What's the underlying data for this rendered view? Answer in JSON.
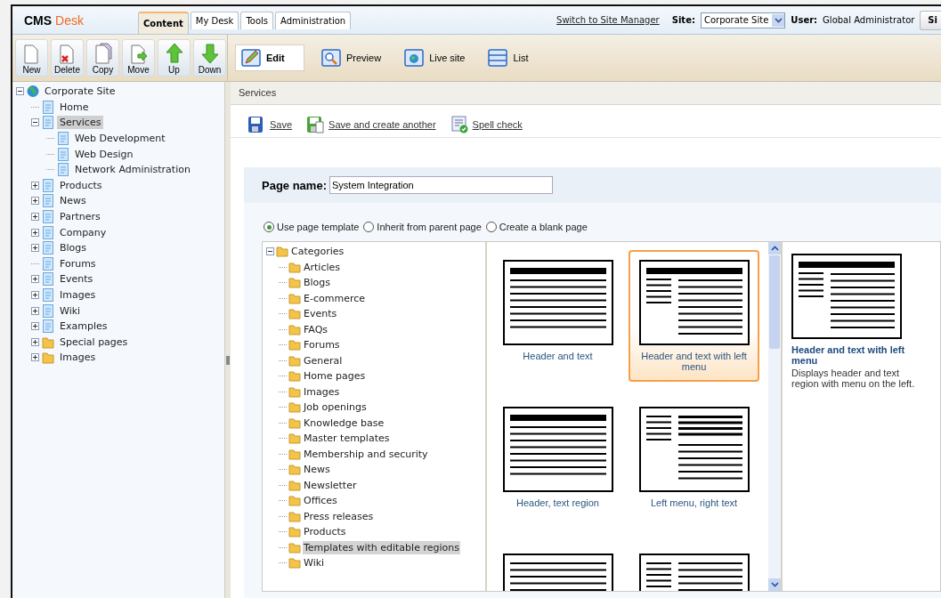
{
  "header": {
    "logo_bold": "CMS",
    "logo_accent": "Desk",
    "tabs": [
      {
        "label": "Content",
        "selected": true
      },
      {
        "label": "My Desk",
        "selected": false
      },
      {
        "label": "Tools",
        "selected": false
      },
      {
        "label": "Administration",
        "selected": false
      }
    ],
    "switch_link": "Switch to Site Manager",
    "site_label": "Site:",
    "site_value": "Corporate Site",
    "user_label": "User:",
    "user_value": "Global Administrator",
    "sign_button": "Si"
  },
  "tree_toolbar": [
    {
      "label": "New",
      "kind": "new"
    },
    {
      "label": "Delete",
      "kind": "delete"
    },
    {
      "label": "Copy",
      "kind": "copy"
    },
    {
      "label": "Move",
      "kind": "move"
    },
    {
      "label": "Up",
      "kind": "up"
    },
    {
      "label": "Down",
      "kind": "down"
    }
  ],
  "view_modes": [
    {
      "label": "Edit",
      "kind": "edit",
      "selected": true
    },
    {
      "label": "Preview",
      "kind": "preview",
      "selected": false
    },
    {
      "label": "Live site",
      "kind": "live",
      "selected": false
    },
    {
      "label": "List",
      "kind": "list",
      "selected": false
    }
  ],
  "site_tree": [
    {
      "label": "Corporate Site",
      "kind": "globe",
      "has_children": true,
      "expanded": true,
      "selected": false,
      "children": [
        {
          "label": "Home",
          "kind": "page",
          "has_children": false,
          "expanded": false,
          "selected": false
        },
        {
          "label": "Services",
          "kind": "page",
          "has_children": true,
          "expanded": true,
          "selected": true,
          "children": [
            {
              "label": "Web Development",
              "kind": "page",
              "has_children": false,
              "expanded": false,
              "selected": false
            },
            {
              "label": "Web Design",
              "kind": "page",
              "has_children": false,
              "expanded": false,
              "selected": false
            },
            {
              "label": "Network Administration",
              "kind": "page",
              "has_children": false,
              "expanded": false,
              "selected": false
            }
          ]
        },
        {
          "label": "Products",
          "kind": "page",
          "has_children": true,
          "expanded": false,
          "selected": false
        },
        {
          "label": "News",
          "kind": "page",
          "has_children": true,
          "expanded": false,
          "selected": false
        },
        {
          "label": "Partners",
          "kind": "page",
          "has_children": true,
          "expanded": false,
          "selected": false
        },
        {
          "label": "Company",
          "kind": "page",
          "has_children": true,
          "expanded": false,
          "selected": false
        },
        {
          "label": "Blogs",
          "kind": "page",
          "has_children": true,
          "expanded": false,
          "selected": false
        },
        {
          "label": "Forums",
          "kind": "page",
          "has_children": false,
          "expanded": false,
          "selected": false
        },
        {
          "label": "Events",
          "kind": "page",
          "has_children": true,
          "expanded": false,
          "selected": false
        },
        {
          "label": "Images",
          "kind": "page",
          "has_children": true,
          "expanded": false,
          "selected": false
        },
        {
          "label": "Wiki",
          "kind": "page",
          "has_children": true,
          "expanded": false,
          "selected": false
        },
        {
          "label": "Examples",
          "kind": "page",
          "has_children": true,
          "expanded": false,
          "selected": false
        },
        {
          "label": "Special pages",
          "kind": "folder",
          "has_children": true,
          "expanded": false,
          "selected": false
        },
        {
          "label": "Images",
          "kind": "folder",
          "has_children": true,
          "expanded": false,
          "selected": false
        }
      ]
    }
  ],
  "breadcrumb": "Services",
  "actions": [
    {
      "label": "Save",
      "kind": "save"
    },
    {
      "label": "Save and create another",
      "kind": "save-another"
    },
    {
      "label": "Spell check",
      "kind": "spell"
    }
  ],
  "page_name": {
    "label": "Page name:",
    "value": "System Integration"
  },
  "template_options": [
    {
      "label": "Use page template",
      "selected": true
    },
    {
      "label": "Inherit from parent page",
      "selected": false
    },
    {
      "label": "Create a blank page",
      "selected": false
    }
  ],
  "categories": {
    "label": "Categories",
    "expanded": true,
    "children": [
      {
        "label": "Articles",
        "selected": false
      },
      {
        "label": "Blogs",
        "selected": false
      },
      {
        "label": "E-commerce",
        "selected": false
      },
      {
        "label": "Events",
        "selected": false
      },
      {
        "label": "FAQs",
        "selected": false
      },
      {
        "label": "Forums",
        "selected": false
      },
      {
        "label": "General",
        "selected": false
      },
      {
        "label": "Home pages",
        "selected": false
      },
      {
        "label": "Images",
        "selected": false
      },
      {
        "label": "Job openings",
        "selected": false
      },
      {
        "label": "Knowledge base",
        "selected": false
      },
      {
        "label": "Master templates",
        "selected": false
      },
      {
        "label": "Membership and security",
        "selected": false
      },
      {
        "label": "News",
        "selected": false
      },
      {
        "label": "Newsletter",
        "selected": false
      },
      {
        "label": "Offices",
        "selected": false
      },
      {
        "label": "Press releases",
        "selected": false
      },
      {
        "label": "Products",
        "selected": false
      },
      {
        "label": "Templates with editable regions",
        "selected": true
      },
      {
        "label": "Wiki",
        "selected": false
      }
    ]
  },
  "templates": [
    {
      "label": "Header and text",
      "kind": "header-text",
      "selected": false
    },
    {
      "label": "Header and text with left menu",
      "kind": "header-menu",
      "selected": true
    },
    {
      "label": "Header, text region",
      "kind": "header-text",
      "selected": false
    },
    {
      "label": "Left menu, right text",
      "kind": "menu-text",
      "selected": false
    },
    {
      "kind": "lines",
      "selected": false
    },
    {
      "kind": "menu-lines",
      "selected": false
    }
  ],
  "template_detail": {
    "kind": "header-menu",
    "title": "Header and text with left menu",
    "description": "Displays header and text region with menu on the left."
  }
}
